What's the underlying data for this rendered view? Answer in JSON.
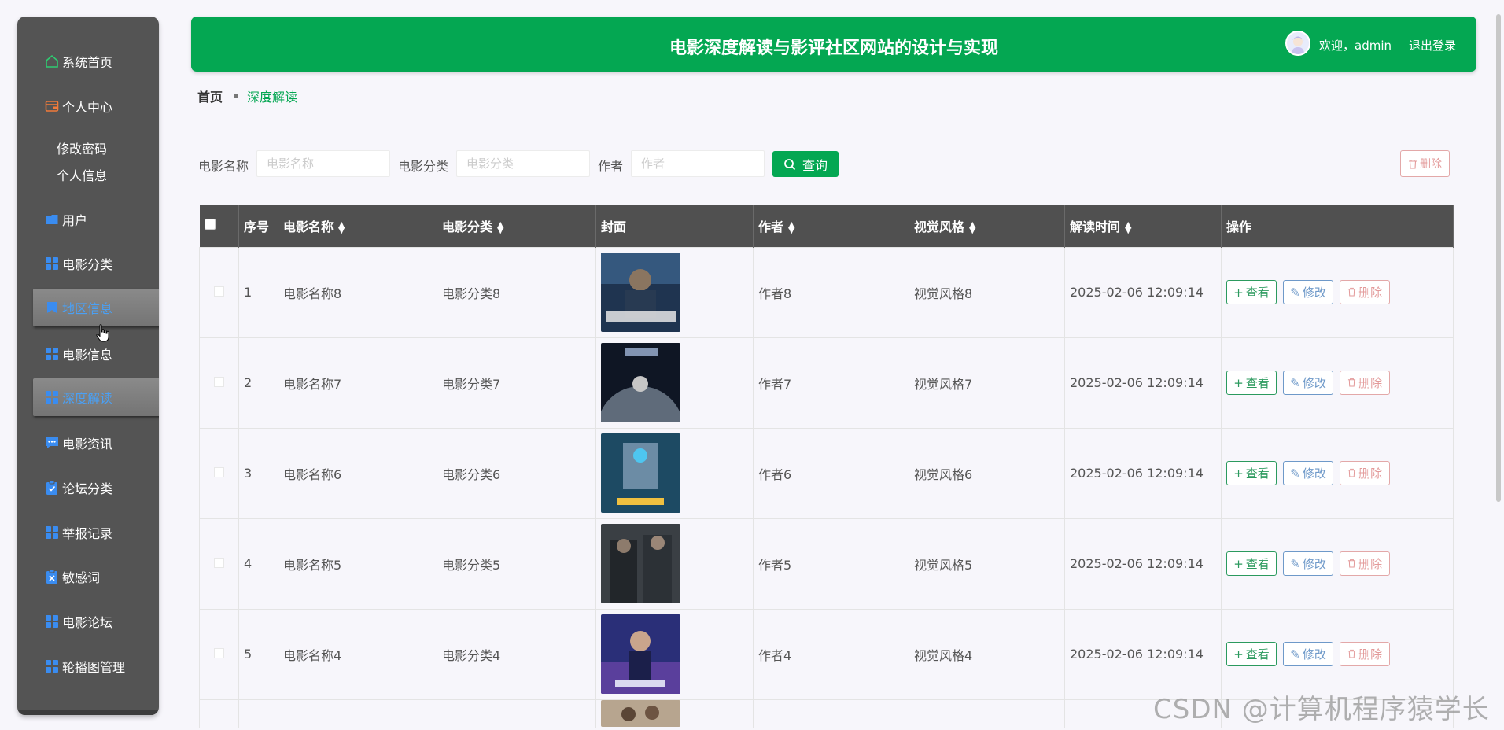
{
  "sidebar": {
    "items": [
      {
        "label": "系统首页",
        "icon": "home-icon",
        "color": "#2ecc71"
      },
      {
        "label": "个人中心",
        "icon": "wallet-icon",
        "color": "#f07a3a"
      },
      {
        "label": "用户",
        "icon": "folder-icon",
        "color": "#3a8cf0"
      },
      {
        "label": "电影分类",
        "icon": "grid-icon",
        "color": "#3a8cf0"
      },
      {
        "label": "地区信息",
        "icon": "bookmark-icon",
        "color": "#3a8cf0"
      },
      {
        "label": "电影信息",
        "icon": "grid-icon",
        "color": "#3a8cf0"
      },
      {
        "label": "深度解读",
        "icon": "grid-icon",
        "color": "#3a8cf0"
      },
      {
        "label": "电影资讯",
        "icon": "chat-icon",
        "color": "#3a8cf0"
      },
      {
        "label": "论坛分类",
        "icon": "clipboard-icon",
        "color": "#3a8cf0"
      },
      {
        "label": "举报记录",
        "icon": "grid-icon",
        "color": "#3a8cf0"
      },
      {
        "label": "敏感词",
        "icon": "x-box-icon",
        "color": "#3a8cf0"
      },
      {
        "label": "电影论坛",
        "icon": "grid-icon",
        "color": "#3a8cf0"
      },
      {
        "label": "轮播图管理",
        "icon": "grid-icon",
        "color": "#3a8cf0"
      }
    ],
    "sub_items": [
      "修改密码",
      "个人信息"
    ],
    "active_highlight_color": "#4aa0f5"
  },
  "header": {
    "title": "电影深度解读与影评社区网站的设计与实现",
    "welcome": "欢迎，admin",
    "logout": "退出登录",
    "bg_color": "#04a752"
  },
  "breadcrumb": {
    "home": "首页",
    "current": "深度解读"
  },
  "search": {
    "name_label": "电影名称",
    "name_placeholder": "电影名称",
    "category_label": "电影分类",
    "category_placeholder": "电影分类",
    "author_label": "作者",
    "author_placeholder": "作者",
    "query_button": "查询",
    "batch_delete_button": "删除"
  },
  "table": {
    "columns": [
      "序号",
      "电影名称",
      "电影分类",
      "封面",
      "作者",
      "视觉风格",
      "解读时间",
      "操作"
    ],
    "rows": [
      {
        "index": "1",
        "name": "电影名称8",
        "category": "电影分类8",
        "author": "作者8",
        "style": "视觉风格8",
        "time": "2025-02-06 12:09:14"
      },
      {
        "index": "2",
        "name": "电影名称7",
        "category": "电影分类7",
        "author": "作者7",
        "style": "视觉风格7",
        "time": "2025-02-06 12:09:14"
      },
      {
        "index": "3",
        "name": "电影名称6",
        "category": "电影分类6",
        "author": "作者6",
        "style": "视觉风格6",
        "time": "2025-02-06 12:09:14"
      },
      {
        "index": "4",
        "name": "电影名称5",
        "category": "电影分类5",
        "author": "作者5",
        "style": "视觉风格5",
        "time": "2025-02-06 12:09:14"
      },
      {
        "index": "5",
        "name": "电影名称4",
        "category": "电影分类4",
        "author": "作者4",
        "style": "视觉风格4",
        "time": "2025-02-06 12:09:14"
      }
    ],
    "actions": {
      "view": "查看",
      "edit": "修改",
      "delete": "删除"
    },
    "header_bg": "#505050"
  },
  "watermark": "CSDN @计算机程序猿学长"
}
